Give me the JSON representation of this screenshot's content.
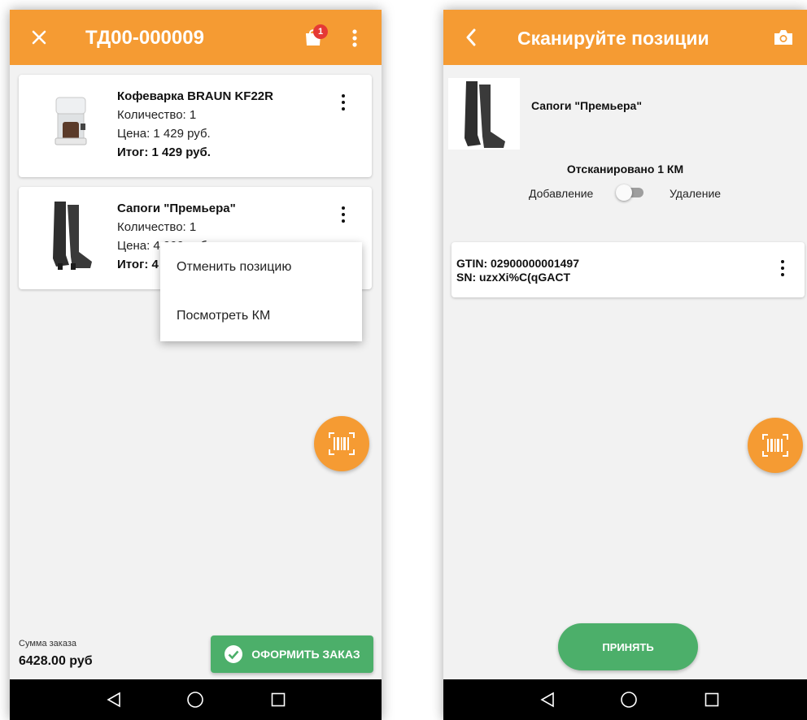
{
  "left": {
    "header": {
      "title": "ТД00-000009",
      "close_icon": "close-icon",
      "cart_icon": "cart-icon",
      "more_icon": "more-vert-icon",
      "badge": "1"
    },
    "items": [
      {
        "name": "Кофеварка BRAUN KF22R",
        "qty": "Количество: 1",
        "price": "Цена: 1 429 руб.",
        "total": "Итог: 1 429 руб."
      },
      {
        "name": "Сапоги \"Премьера\"",
        "qty": "Количество: 1",
        "price": "Цена: 4 999 руб.",
        "total": "Итог: 4 999 руб."
      }
    ],
    "context_menu": {
      "cancel": "Отменить позицию",
      "view_km": "Посмотреть КМ"
    },
    "footer": {
      "sum_label": "Сумма заказа",
      "sum_value": "6428.00 руб",
      "checkout": "ОФОРМИТЬ ЗАКАЗ"
    }
  },
  "right": {
    "header": {
      "title": "Сканируйте позиции",
      "back_icon": "back-arrow-icon",
      "camera_icon": "camera-icon"
    },
    "product": {
      "name": "Сапоги \"Премьера\""
    },
    "scanned": "Отсканировано 1 КМ",
    "toggle": {
      "left": "Добавление",
      "right": "Удаление",
      "state": "off"
    },
    "code": {
      "gtin": "GTIN: 02900000001497",
      "sn": "SN: uzxXi%C(qGACT"
    },
    "accept": "ПРИНЯТЬ"
  },
  "colors": {
    "accent": "#f59b33",
    "green": "#4caf6a",
    "badge": "#e53935",
    "navbar": "#000000"
  }
}
